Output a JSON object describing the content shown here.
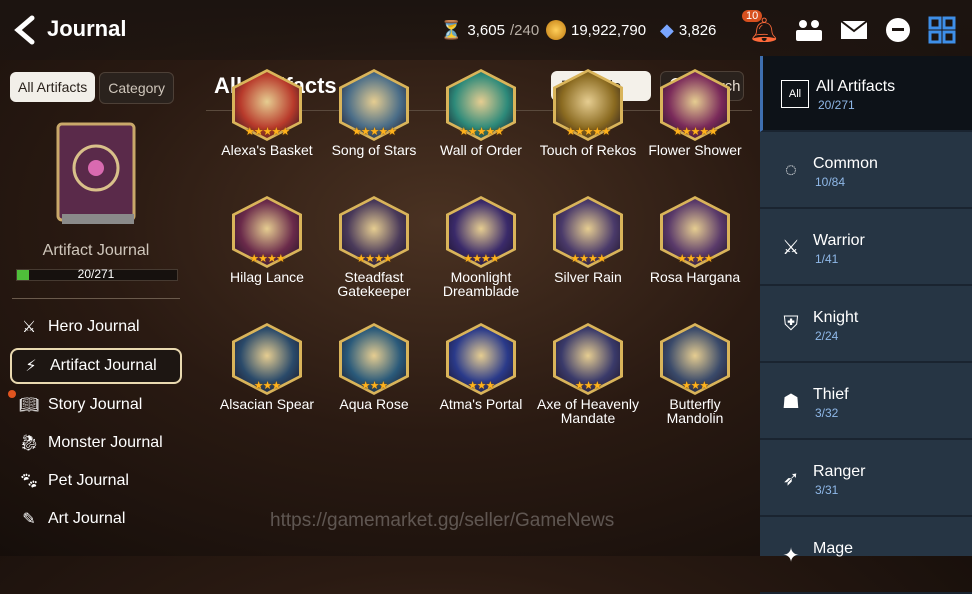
{
  "header": {
    "title": "Journal",
    "resources": [
      {
        "icon": "stamina-icon",
        "value": "3,605",
        "cap": "/240"
      },
      {
        "icon": "gold-icon",
        "value": "19,922,790",
        "cap": ""
      },
      {
        "icon": "crystal-icon",
        "value": "3,826",
        "cap": ""
      }
    ],
    "notification_count": "10"
  },
  "left": {
    "tabs": [
      "All Artifacts",
      "Category"
    ],
    "book_label": "Artifact Journal",
    "progress_text": "20/271",
    "progress_fraction": 0.074,
    "menu": [
      {
        "label": "Hero Journal",
        "icon": "hero-icon"
      },
      {
        "label": "Artifact Journal",
        "icon": "lightning-icon"
      },
      {
        "label": "Story Journal",
        "icon": "story-icon"
      },
      {
        "label": "Monster Journal",
        "icon": "monster-icon"
      },
      {
        "label": "Pet Journal",
        "icon": "paw-icon"
      },
      {
        "label": "Art Journal",
        "icon": "art-icon"
      }
    ]
  },
  "main": {
    "title": "All Artifacts",
    "grade_label": "Grade",
    "search_label": "Search",
    "artifacts": [
      {
        "name": "Alexa's Basket",
        "stars": "★★★★★",
        "color": "#b83a2b"
      },
      {
        "name": "Song of Stars",
        "stars": "★★★★★",
        "color": "#4a6d88"
      },
      {
        "name": "Wall of Order",
        "stars": "★★★★★",
        "color": "#2d8a7a"
      },
      {
        "name": "Touch of Rekos",
        "stars": "★★★★★",
        "color": "#8a6a20"
      },
      {
        "name": "Flower Shower",
        "stars": "★★★★★",
        "color": "#7a2a5a"
      },
      {
        "name": "Hilag Lance",
        "stars": "★★★★",
        "color": "#6a2a4a"
      },
      {
        "name": "Steadfast Gatekeeper",
        "stars": "★★★★",
        "color": "#4a3a5a"
      },
      {
        "name": "Moonlight Dreamblade",
        "stars": "★★★★",
        "color": "#3a2a6a"
      },
      {
        "name": "Silver Rain",
        "stars": "★★★★",
        "color": "#4a3a6a"
      },
      {
        "name": "Rosa Hargana",
        "stars": "★★★★",
        "color": "#5a3a6a"
      },
      {
        "name": "Alsacian Spear",
        "stars": "★★★",
        "color": "#2a4a6a"
      },
      {
        "name": "Aqua Rose",
        "stars": "★★★",
        "color": "#2a5a7a"
      },
      {
        "name": "Atma's Portal",
        "stars": "★★★",
        "color": "#2a3a8a"
      },
      {
        "name": "Axe of Heavenly Mandate",
        "stars": "★★★",
        "color": "#3a3a6a"
      },
      {
        "name": "Butterfly Mandolin",
        "stars": "★★★",
        "color": "#3a4a6a"
      }
    ]
  },
  "categories": [
    {
      "name": "All Artifacts",
      "count": "20/271",
      "icon": "all-icon"
    },
    {
      "name": "Common",
      "count": "10/84",
      "icon": "common-icon"
    },
    {
      "name": "Warrior",
      "count": "1/41",
      "icon": "warrior-icon"
    },
    {
      "name": "Knight",
      "count": "2/24",
      "icon": "knight-icon"
    },
    {
      "name": "Thief",
      "count": "3/32",
      "icon": "thief-icon"
    },
    {
      "name": "Ranger",
      "count": "3/31",
      "icon": "ranger-icon"
    },
    {
      "name": "Mage",
      "count": "",
      "icon": "mage-icon"
    }
  ],
  "watermark": "https://gamemarket.gg/seller/GameNews"
}
